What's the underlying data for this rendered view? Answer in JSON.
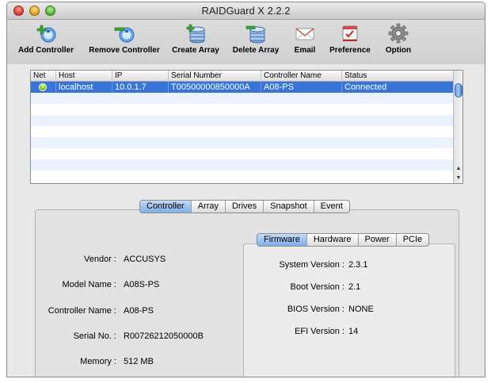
{
  "window": {
    "title": "RAIDGuard X 2.2.2"
  },
  "toolbar": {
    "items": [
      {
        "label": "Add Controller",
        "icon": "add-controller-icon"
      },
      {
        "label": "Remove Controller",
        "icon": "remove-controller-icon"
      },
      {
        "label": "Create Array",
        "icon": "create-array-icon"
      },
      {
        "label": "Delete Array",
        "icon": "delete-array-icon"
      },
      {
        "label": "Email",
        "icon": "email-icon"
      },
      {
        "label": "Preference",
        "icon": "preference-icon"
      },
      {
        "label": "Option",
        "icon": "gear-icon"
      }
    ]
  },
  "table": {
    "columns": [
      "Net",
      "Host",
      "IP",
      "Serial Number",
      "Controller Name",
      "Status"
    ],
    "rows": [
      {
        "host": "localhost",
        "ip": "10.0.1.7",
        "serial": "T00500000850000A",
        "controller": "A08-PS",
        "status": "Connected",
        "net_status_color": "#7fc31a"
      }
    ]
  },
  "main_tabs": {
    "items": [
      "Controller",
      "Array",
      "Drives",
      "Snapshot",
      "Event"
    ],
    "selected": "Controller"
  },
  "controller_info": {
    "vendor_label": "Vendor :",
    "vendor": "ACCUSYS",
    "model_label": "Model Name :",
    "model": "A08S-PS",
    "name_label": "Controller Name :",
    "name": "A08-PS",
    "serial_label": "Serial No. :",
    "serial": "R00726212050000B",
    "memory_label": "Memory :",
    "memory": "512 MB"
  },
  "sub_tabs": {
    "items": [
      "Firmware",
      "Hardware",
      "Power",
      "PCIe"
    ],
    "selected": "Firmware"
  },
  "firmware": {
    "system_label": "System Version :",
    "system": "2.3.1",
    "boot_label": "Boot Version :",
    "boot": "2.1",
    "bios_label": "BIOS Version :",
    "bios": "NONE",
    "efi_label": "EFI Version :",
    "efi": "14"
  },
  "colors": {
    "selection": "#3875d7",
    "accent": "#7eaee8"
  }
}
